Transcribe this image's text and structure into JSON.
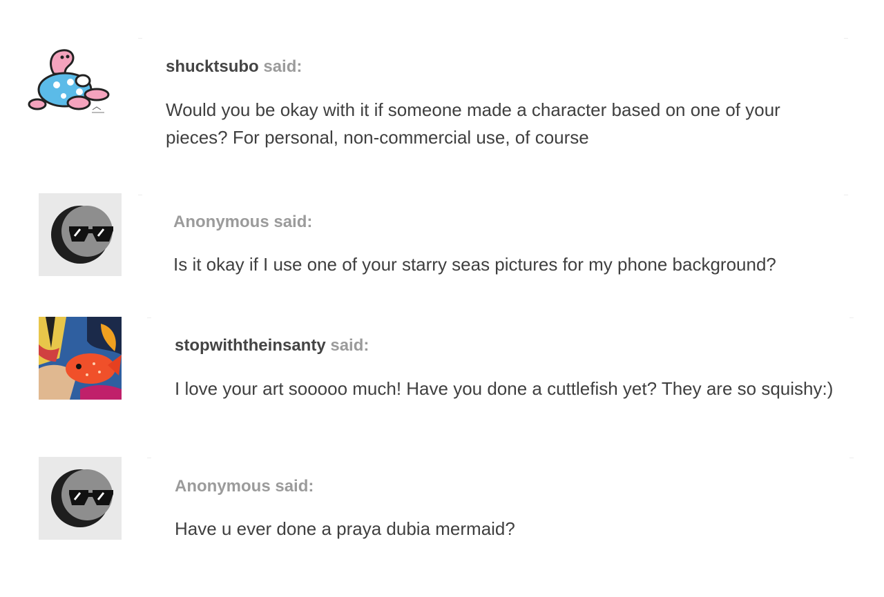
{
  "asks": [
    {
      "asker": "shucktsubo",
      "said": "said:",
      "anonymous": false,
      "avatar": "pink-creature-avatar",
      "question": "Would you be okay with it if someone made a character based on one of your pieces? For personal, non-commercial use, of course"
    },
    {
      "asker": "Anonymous",
      "said": "said:",
      "anonymous": true,
      "avatar": "anonymous-sunglasses-avatar",
      "question": "Is it okay if I use one of your starry seas pictures for my phone background?"
    },
    {
      "asker": "stopwiththeinsanty",
      "said": "said:",
      "anonymous": false,
      "avatar": "colorful-fish-avatar",
      "question": "I love your art sooooo much! Have you done a cuttlefish yet? They are so squishy:)"
    },
    {
      "asker": "Anonymous",
      "said": "said:",
      "anonymous": true,
      "avatar": "anonymous-sunglasses-avatar",
      "question": "Have u ever done a praya dubia mermaid?"
    }
  ],
  "colors": {
    "username": "#444444",
    "said": "#9b9b9b",
    "question_text": "#3f3f3f",
    "anon_avatar_bg": "#e9e9e9"
  }
}
